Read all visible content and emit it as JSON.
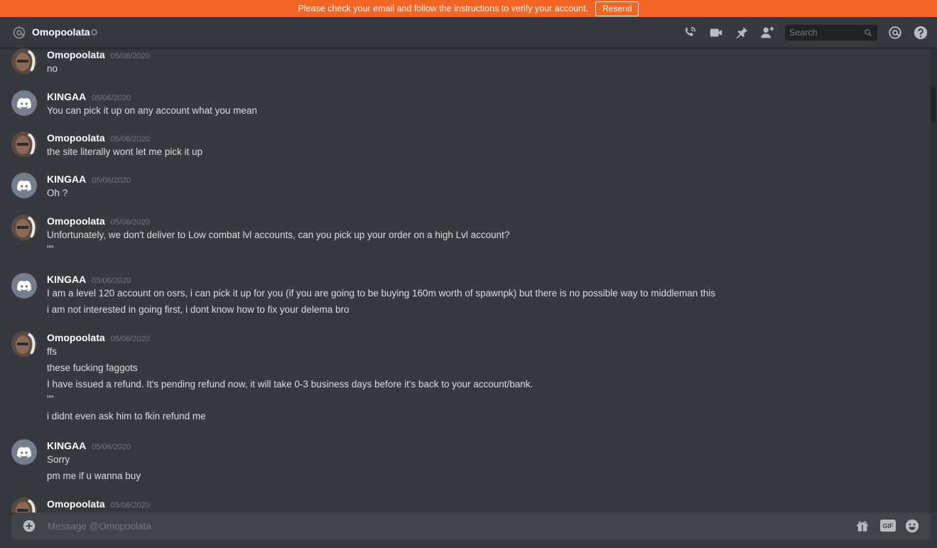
{
  "notice": {
    "text": "Please check your email and follow the instructions to verify your account.",
    "resend_label": "Resend"
  },
  "header": {
    "channel_name": "Omopoolata",
    "search_placeholder": "Search"
  },
  "composer": {
    "placeholder": "Message @Omopoolata",
    "gif_label": "GIF"
  },
  "messages": [
    {
      "author": "Omopoolata",
      "timestamp": "05/06/2020",
      "lines": [
        "no"
      ]
    },
    {
      "author": "KINGAA",
      "timestamp": "05/06/2020",
      "lines": [
        "You can pick it up on any account what you mean"
      ]
    },
    {
      "author": "Omopoolata",
      "timestamp": "05/06/2020",
      "lines": [
        "the site literally wont let me pick it up"
      ]
    },
    {
      "author": "KINGAA",
      "timestamp": "05/06/2020",
      "lines": [
        "Oh ?"
      ]
    },
    {
      "author": "Omopoolata",
      "timestamp": "05/06/2020",
      "lines": [
        "Unfortunately, we don't deliver to Low combat lvl accounts, can you pick up your order on a high Lvl account?",
        "\"\""
      ]
    },
    {
      "author": "KINGAA",
      "timestamp": "05/06/2020",
      "lines": [
        "I am a level 120 account on osrs, i can pick it up for you (if you are going to be buying 160m worth of spawnpk) but there is no possible way to middleman this",
        "i am not interested in going first, i dont know how to fix your delema bro"
      ]
    },
    {
      "author": "Omopoolata",
      "timestamp": "05/06/2020",
      "lines": [
        "ffs",
        "these fucking faggots",
        "I have issued a refund. It's pending refund now, it will take 0-3 business days before it's back to your account/bank.",
        "\"\"",
        "i didnt even ask him to fkin refund me"
      ]
    },
    {
      "author": "KINGAA",
      "timestamp": "05/06/2020",
      "lines": [
        "Sorry",
        "pm me if u wanna buy"
      ]
    },
    {
      "author": "Omopoolata",
      "timestamp": "05/06/2020",
      "lines": []
    }
  ],
  "colors": {
    "notice_bg": "#f26522",
    "chat_bg": "#36393f",
    "composer_bg": "#40444b",
    "avatar_discord_bg": "#747f8d"
  }
}
